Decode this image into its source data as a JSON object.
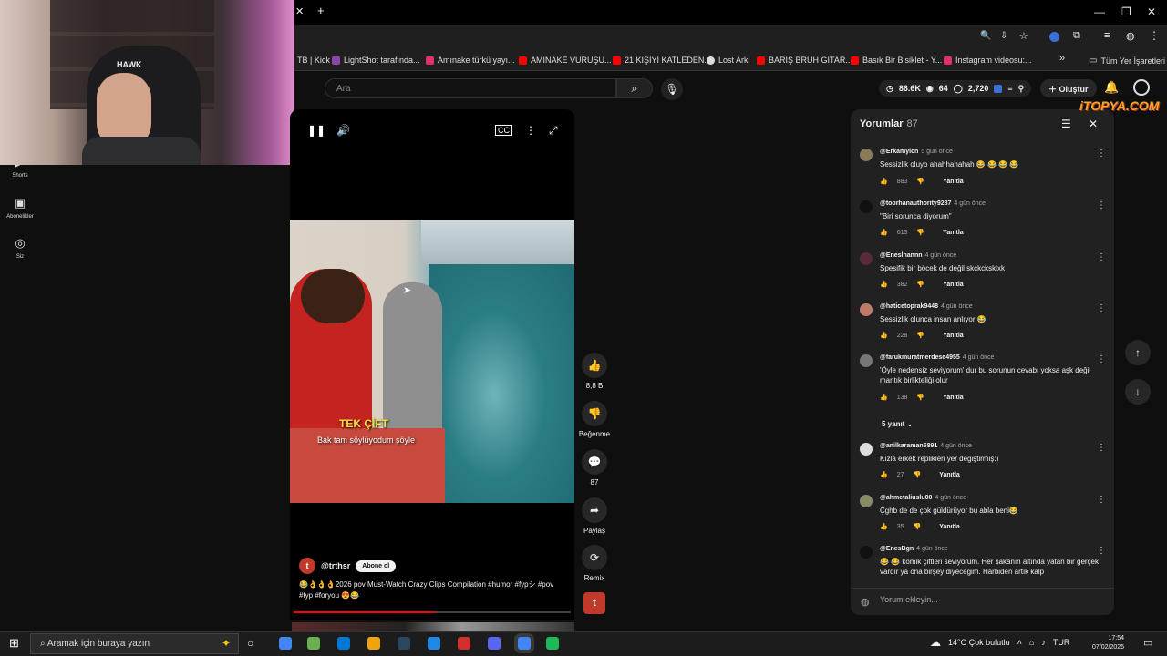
{
  "browser": {
    "bookmarks": [
      {
        "label": "TB | Kick",
        "color": "#53fc18"
      },
      {
        "label": "LightShot tarafında...",
        "color": "#8e44ad"
      },
      {
        "label": "Amınake türkü yayı...",
        "color": "#e1306c"
      },
      {
        "label": "AMINAKE VURUŞU...",
        "color": "#ff0000"
      },
      {
        "label": "21 KİŞİYİ KATLEDEN...",
        "color": "#ff0000"
      },
      {
        "label": "Lost Ark",
        "color": "#dddddd"
      },
      {
        "label": "BARIŞ BRUH GİTAR...",
        "color": "#ff0000"
      },
      {
        "label": "Basık Bir Bisiklet - Y...",
        "color": "#ff0000"
      },
      {
        "label": "Instagram videosu:...",
        "color": "#e1306c"
      }
    ],
    "bookmarks_more": "»",
    "all_bookmarks": "Tüm Yer İşaretleri",
    "new_tab_icon": "plus-icon"
  },
  "youtube": {
    "search_placeholder": "Ara",
    "stats": {
      "views": "86.6K",
      "viewers": "64",
      "subs": "2,720"
    },
    "create_label": "Oluştur",
    "sidebar": [
      {
        "label": "Shorts",
        "icon": "shorts-icon"
      },
      {
        "label": "Abonelikler",
        "icon": "subscriptions-icon"
      },
      {
        "label": "Siz",
        "icon": "user-icon"
      }
    ],
    "short": {
      "caption": "TEK ÇİFT",
      "subtitle": "Bak tam söylüyodum şöyle",
      "channel": "@trthsr",
      "channel_initial": "t",
      "subscribe_label": "Abone ol",
      "description": "😂👌👌👌2026 pov Must-Watch Crazy Clips Compilation #humor #fypシ #pov #fyp #foryou 😍😂",
      "progress": 0.51
    },
    "actions": {
      "likes": "8,8 B",
      "dislike_label": "Beğenme",
      "comments": "87",
      "share_label": "Paylaş",
      "remix_label": "Remix"
    },
    "comments_panel": {
      "title": "Yorumlar",
      "count": "87",
      "input_placeholder": "Yorum ekleyin...",
      "reply_label": "Yanıtla",
      "comments": [
        {
          "user": "@Erkamylcn",
          "time": "5 gün önce",
          "text": "Sessizlik oluyo ahahhahahah 😂 😂 😂 😂",
          "likes": "883",
          "avatar": "#8a7a5a"
        },
        {
          "user": "@toorhanauthority9287",
          "time": "4 gün önce",
          "text": "\"Biri sorunca diyorum\"",
          "likes": "613",
          "avatar": "#111111"
        },
        {
          "user": "@Enesİnannn",
          "time": "4 gün önce",
          "text": "Spesifik bir böcek de değil skckcksklxk",
          "likes": "382",
          "avatar": "#5a2a3a"
        },
        {
          "user": "@haticetoprak9448",
          "time": "4 gün önce",
          "text": "Sessizlik olunca insan anlıyor 😂",
          "likes": "228",
          "avatar": "#c07a6a"
        },
        {
          "user": "@farukmuratmerdese4955",
          "time": "4 gün önce",
          "text": "'Öyle nedensiz seviyorum' dur bu sorunun cevabı yoksa aşk değil mantık birlikteliği olur",
          "likes": "138",
          "avatar": "#777777"
        },
        {
          "user": "@anilkaraman5891",
          "time": "4 gün önce",
          "text": "Kızla erkek replikleri yer değiştirmiş:)",
          "likes": "27",
          "avatar": "#dddddd"
        },
        {
          "user": "@ahmetaliuslu00",
          "time": "4 gün önce",
          "text": "Çghb de de çok güldürüyor bu abla beni😂",
          "likes": "35",
          "avatar": "#8a8a6a"
        },
        {
          "user": "@EnesBgn",
          "time": "4 gün önce",
          "text": "😂 😂 komik çiftleri seviyorum. Her şakanın altında yatan bir gerçek vardır ya ona birşey diyeceğim.  Harbiden artık kalp",
          "likes": "",
          "avatar": "#111111"
        }
      ],
      "replies_toggle": "5 yanıt"
    },
    "watermark": "iTOPYA.COM"
  },
  "webcam": {
    "chair_brand": "HAWK"
  },
  "taskbar": {
    "search_placeholder": "Aramak için buraya yazın",
    "weather": "14°C  Çok bulutlu",
    "lang": "TUR",
    "time": "17:54",
    "date": "07/02/2026",
    "apps": [
      "#4285f4",
      "#6ab04c",
      "#0078d7",
      "#f0a30a",
      "#2a475e",
      "#1e88e5",
      "#d32f2f",
      "#5865f2",
      "#4285f4",
      "#1db954"
    ]
  }
}
